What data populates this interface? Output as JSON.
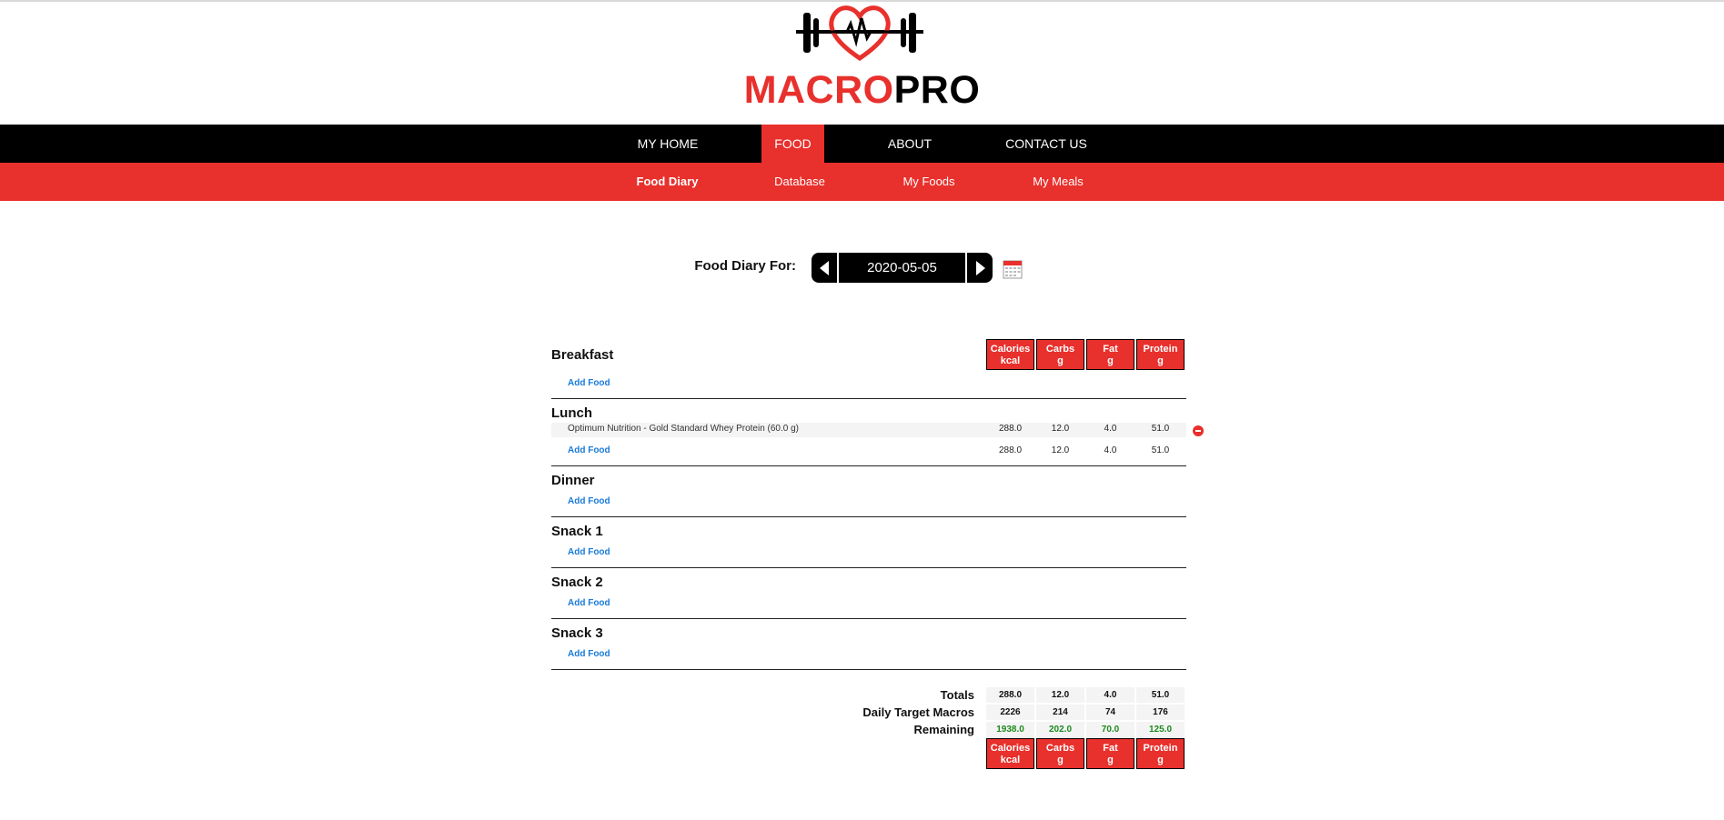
{
  "brand": {
    "name_red": "MACRO",
    "name_black": "PRO",
    "logo_icon": "barbell-heart-icon",
    "accent": "#e8302c"
  },
  "main_nav": [
    {
      "label": "MY HOME"
    },
    {
      "label": "FOOD",
      "active": true
    },
    {
      "label": "ABOUT"
    },
    {
      "label": "CONTACT US"
    }
  ],
  "sub_nav": [
    {
      "label": "Food Diary",
      "active": true
    },
    {
      "label": "Database"
    },
    {
      "label": "My Foods"
    },
    {
      "label": "My Meals"
    }
  ],
  "diary": {
    "label": "Food Diary For:",
    "date": "2020-05-05"
  },
  "columns": [
    {
      "name": "Calories",
      "unit": "kcal"
    },
    {
      "name": "Carbs",
      "unit": "g"
    },
    {
      "name": "Fat",
      "unit": "g"
    },
    {
      "name": "Protein",
      "unit": "g"
    }
  ],
  "add_food_label": "Add Food",
  "meals": [
    {
      "name": "Breakfast",
      "foods": []
    },
    {
      "name": "Lunch",
      "foods": [
        {
          "name": "Optimum Nutrition - Gold Standard Whey Protein (60.0 g)",
          "values": [
            "288.0",
            "12.0",
            "4.0",
            "51.0"
          ]
        }
      ],
      "subtotal": [
        "288.0",
        "12.0",
        "4.0",
        "51.0"
      ]
    },
    {
      "name": "Dinner",
      "foods": []
    },
    {
      "name": "Snack 1",
      "foods": []
    },
    {
      "name": "Snack 2",
      "foods": []
    },
    {
      "name": "Snack 3",
      "foods": []
    }
  ],
  "summary": {
    "totals_label": "Totals",
    "totals": [
      "288.0",
      "12.0",
      "4.0",
      "51.0"
    ],
    "target_label": "Daily Target Macros",
    "target": [
      "2226",
      "214",
      "74",
      "176"
    ],
    "remaining_label": "Remaining",
    "remaining": [
      "1938.0",
      "202.0",
      "70.0",
      "125.0"
    ],
    "remaining_color": "#1c8a1c"
  }
}
